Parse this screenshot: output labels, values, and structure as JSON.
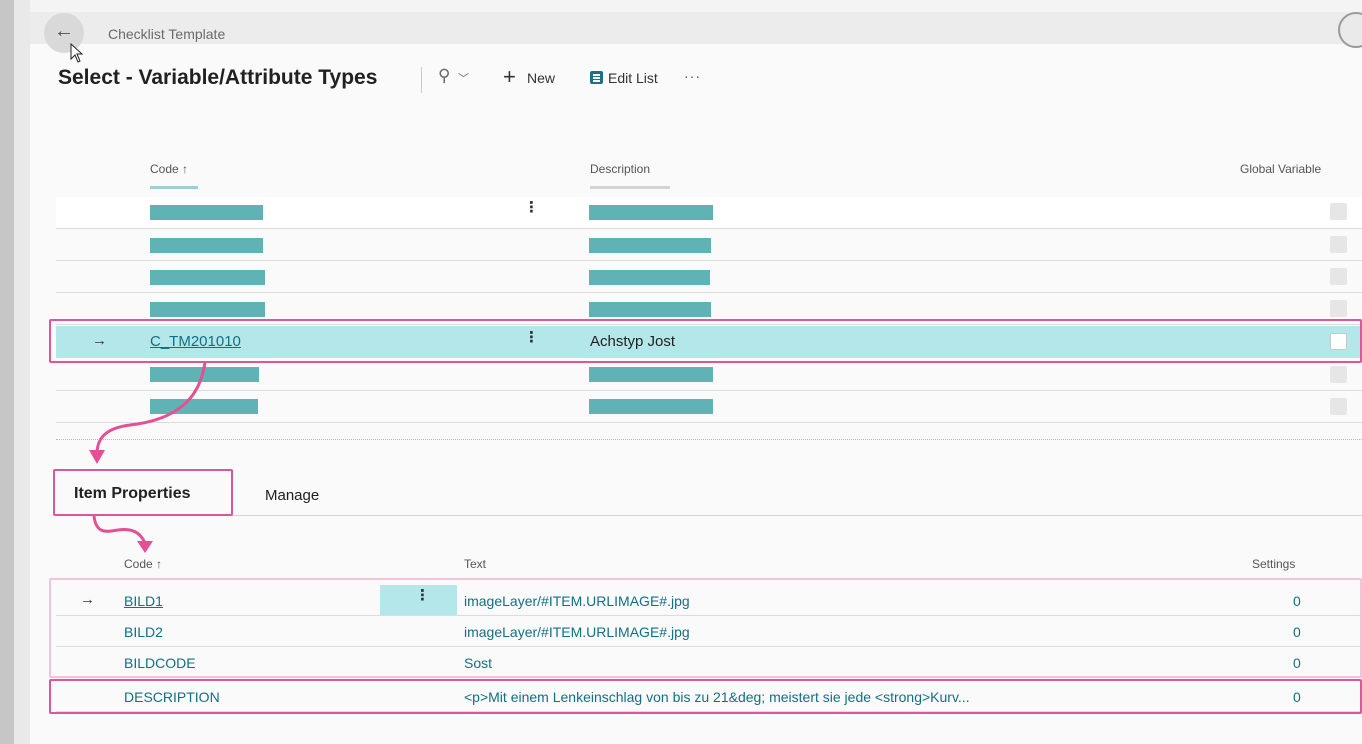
{
  "breadcrumb": "Checklist Template",
  "page_title": "Select - Variable/Attribute Types",
  "toolbar": {
    "new_label": "New",
    "edit_list_label": "Edit List",
    "more": "···"
  },
  "main_table": {
    "columns": [
      "Code ↑",
      "Description",
      "Global Variable"
    ],
    "selected_row": {
      "code": "C_TM201010",
      "description": "Achstyp Jost"
    }
  },
  "tabs": [
    "Item Properties",
    "Manage"
  ],
  "sub_table": {
    "columns": [
      "Code ↑",
      "Text",
      "Settings"
    ],
    "rows": [
      {
        "code": "BILD1",
        "text": "imageLayer/#ITEM.URLIMAGE#.jpg",
        "settings": "0"
      },
      {
        "code": "BILD2",
        "text": "imageLayer/#ITEM.URLIMAGE#.jpg",
        "settings": "0"
      },
      {
        "code": "BILDCODE",
        "text": "Sost",
        "settings": "0"
      },
      {
        "code": "DESCRIPTION",
        "text": "<p>Mit einem Lenkeinschlag von bis zu 21&deg; meistert sie jede <strong>Kurv...",
        "settings": "0"
      }
    ]
  },
  "colors": {
    "accent": "#136f84",
    "selection": "#b3e7ea",
    "redaction": "#5fb3b5",
    "annotation": "#d9579a"
  }
}
